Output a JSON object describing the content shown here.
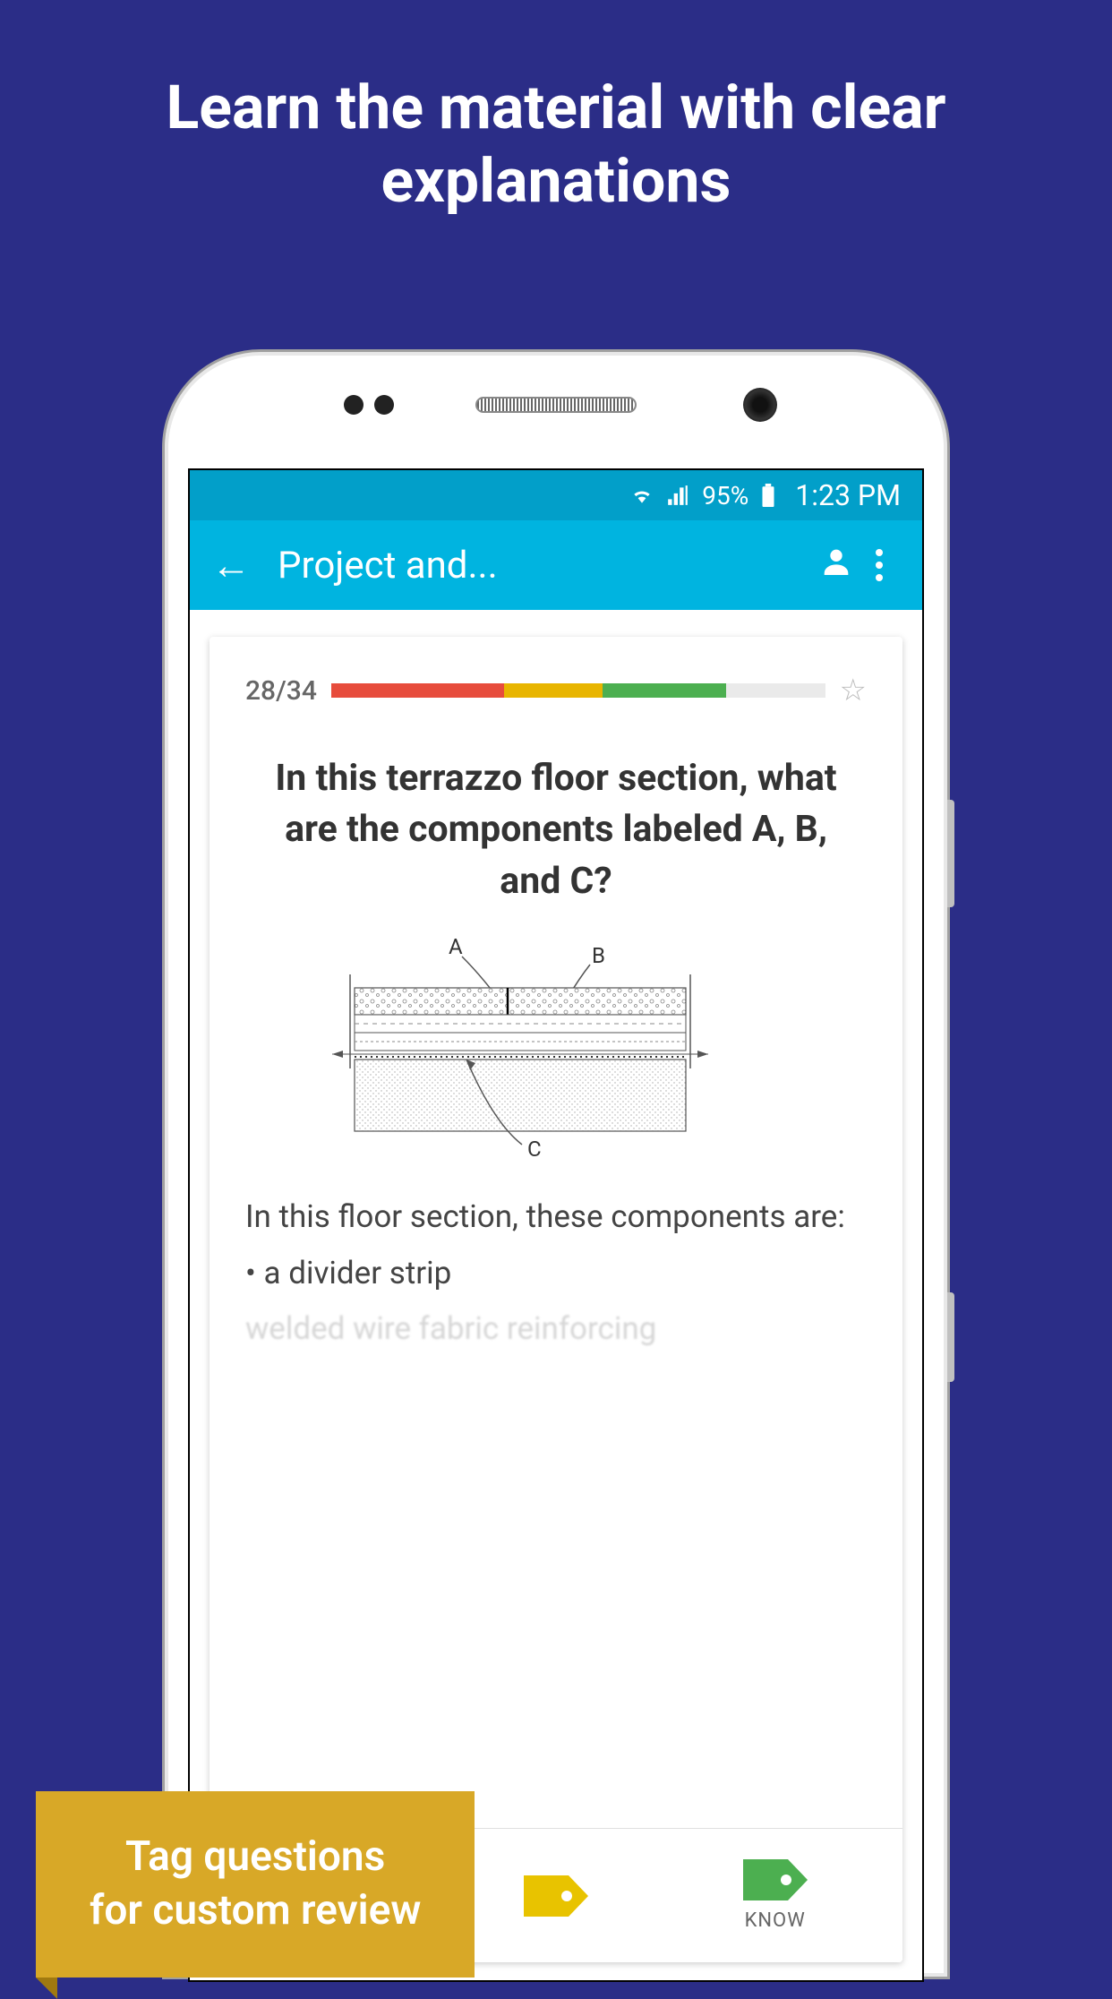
{
  "headline": "Learn the material with clear explanations",
  "status": {
    "battery": "95%",
    "time": "1:23 PM"
  },
  "appbar": {
    "title": "Project and..."
  },
  "card": {
    "progress": "28/34",
    "question": "In this terrazzo floor section, what are the components labeled A, B, and C?",
    "diagram": {
      "labelA": "A",
      "labelB": "B",
      "labelC": "C"
    },
    "answerIntro": "In this floor section, these components are:",
    "bullet1": "• a divider strip",
    "bullet2_cut": "welded wire fabric reinforcing"
  },
  "tags": {
    "know": "KNOW",
    "colors": {
      "red": "#e74c3c",
      "yellow": "#e8c300",
      "green": "#4caf50"
    }
  },
  "callout": "Tag questions\nfor custom review"
}
